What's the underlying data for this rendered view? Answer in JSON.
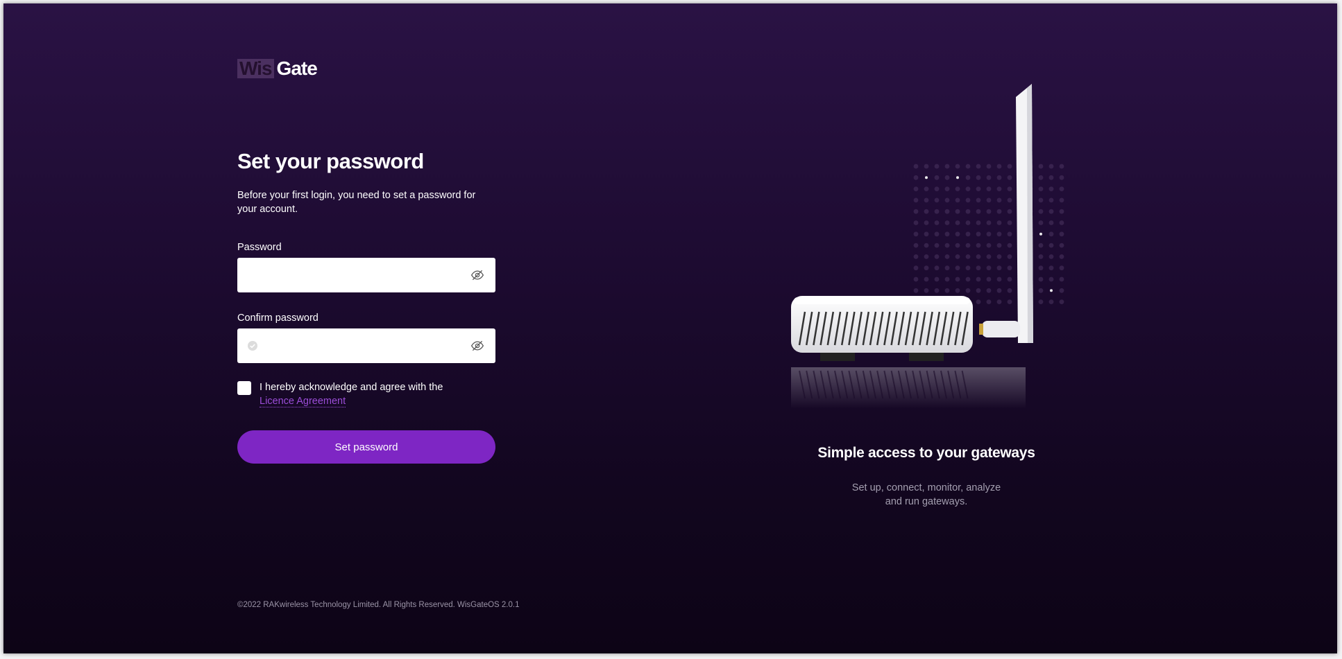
{
  "logo": {
    "wis": "Wis",
    "gate": "Gate"
  },
  "form": {
    "title": "Set your password",
    "intro": "Before your first login, you need to set a password for your account.",
    "password_label": "Password",
    "password_value": "",
    "confirm_label": "Confirm password",
    "confirm_value": "",
    "agree_text": "I hereby acknowledge and agree with the",
    "agree_link": "Licence Agreement",
    "submit_label": "Set password"
  },
  "footer": {
    "text": "©2022 RAKwireless Technology Limited. All Rights Reserved. WisGateOS 2.0.1"
  },
  "hero": {
    "title": "Simple access to your gateways",
    "subtitle_line1": "Set up, connect, monitor, analyze",
    "subtitle_line2": "and run gateways."
  },
  "icons": {
    "password_toggle": "eye-off-icon",
    "confirm_toggle": "eye-off-icon",
    "confirm_status": "check-circle-icon"
  },
  "colors": {
    "accent": "#7e26c4",
    "link": "#9b4dd8",
    "background_top": "#2a1244",
    "background_bottom": "#0d0416"
  }
}
